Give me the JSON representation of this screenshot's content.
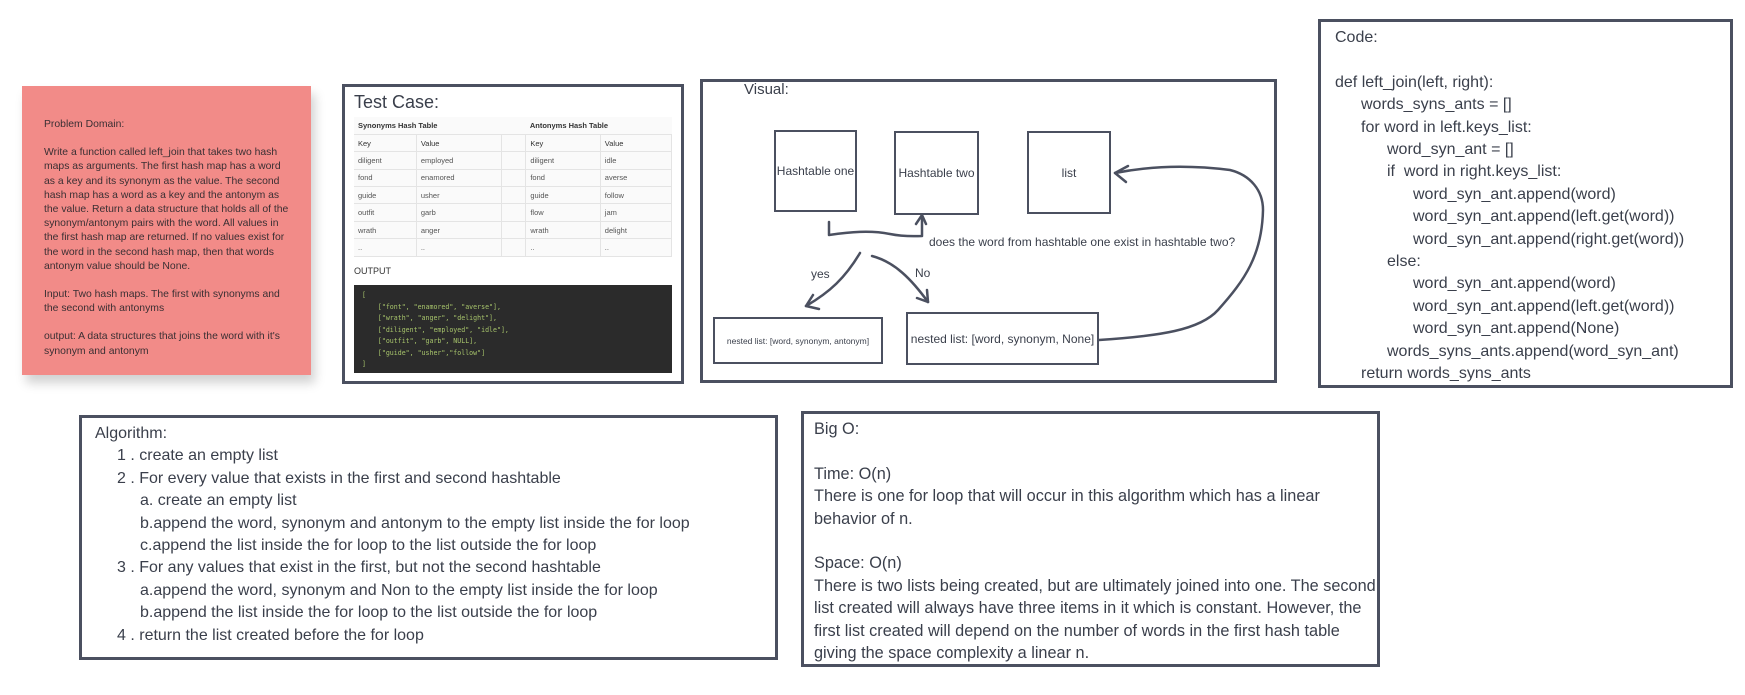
{
  "problem_domain": {
    "heading": "Problem Domain:",
    "description": "Write a function called left_join that takes two hash maps as arguments. The first hash map has a word as a key and its synonym as the value. The second hash map has a word as a key and the antonym as the value. Return a data structure that holds all of the synonym/antonym pairs with the word. All values in the first hash map are returned. If no values exist for the word in the second hash map, then that words antonym value should be None.",
    "input": "Input: Two hash maps. The first with synonyms and the second with antonyms",
    "output": "output: A data structures that joins the word with it's synonym and antonym"
  },
  "test_case": {
    "title": "Test Case:",
    "synonyms_title": "Synonyms Hash Table",
    "antonyms_title": "Antonyms Hash Table",
    "headers": [
      "Key",
      "Value",
      "Key",
      "Value"
    ],
    "rows": [
      [
        "diligent",
        "employed",
        "diligent",
        "idle"
      ],
      [
        "fond",
        "enamored",
        "fond",
        "averse"
      ],
      [
        "guide",
        "usher",
        "guide",
        "follow"
      ],
      [
        "outfit",
        "garb",
        "flow",
        "jam"
      ],
      [
        "wrath",
        "anger",
        "wrath",
        "delight"
      ],
      [
        "..",
        "..",
        "..",
        ".."
      ]
    ],
    "output_label": "OUTPUT",
    "output_code": "[\n    [\"font\", \"enamored\", \"averse\"],\n    [\"wrath\", \"anger\", \"delight\"],\n    [\"diligent\", \"employed\", \"idle\"],\n    [\"outfit\", \"garb\", NULL],\n    [\"guide\", \"usher\",\"follow\"]\n]"
  },
  "visual": {
    "title": "Visual:",
    "hashtable_one": "Hashtable one",
    "hashtable_two": "Hashtable two",
    "list": "list",
    "question": "does the word from hashtable one exist in hashtable two?",
    "yes": "yes",
    "no": "No",
    "nested_yes": "nested list: [word, synonym, antonym]",
    "nested_no": "nested list: [word, synonym, None]"
  },
  "code": {
    "title": "Code:",
    "lines": [
      {
        "indent": 0,
        "text": "def left_join(left, right):"
      },
      {
        "indent": 1,
        "text": "words_syns_ants = []"
      },
      {
        "indent": 1,
        "text": "for word in left.keys_list:"
      },
      {
        "indent": 2,
        "text": "word_syn_ant = []"
      },
      {
        "indent": 2,
        "text": "if  word in right.keys_list:"
      },
      {
        "indent": 3,
        "text": "word_syn_ant.append(word)"
      },
      {
        "indent": 3,
        "text": "word_syn_ant.append(left.get(word))"
      },
      {
        "indent": 3,
        "text": "word_syn_ant.append(right.get(word))"
      },
      {
        "indent": 2,
        "text": "else:"
      },
      {
        "indent": 3,
        "text": "word_syn_ant.append(word)"
      },
      {
        "indent": 3,
        "text": "word_syn_ant.append(left.get(word))"
      },
      {
        "indent": 3,
        "text": "word_syn_ant.append(None)"
      },
      {
        "indent": 2,
        "text": "words_syns_ants.append(word_syn_ant)"
      },
      {
        "indent": 1,
        "text": "return words_syns_ants"
      }
    ]
  },
  "algorithm": {
    "title": "Algorithm:",
    "lines": [
      {
        "indent": 1,
        "text": "1 . create an empty list"
      },
      {
        "indent": 1,
        "text": "2 . For every value that exists in the first and second hashtable"
      },
      {
        "indent": 2,
        "text": "a.  create an empty list"
      },
      {
        "indent": 2,
        "text": "b.append the word, synonym and antonym to the empty list inside the for loop"
      },
      {
        "indent": 2,
        "text": "c.append the list inside the for loop to the list outside the for loop"
      },
      {
        "indent": 1,
        "text": "3 . For any values that exist in the first, but not the second hashtable"
      },
      {
        "indent": 2,
        "text": "a.append the word, synonym and Non to the empty list inside the for loop"
      },
      {
        "indent": 2,
        "text": "b.append the list inside the for loop to the list outside the for loop"
      },
      {
        "indent": 1,
        "text": "4 . return the list created before the for loop"
      }
    ]
  },
  "big_o": {
    "title": "Big O:",
    "time_heading": "Time: O(n)",
    "time_text": "There is one for loop that will occur in this algorithm which has a linear behavior of n.",
    "space_heading": "Space: O(n)",
    "space_text": "There is two lists being created, but are ultimately joined into one. The second list created will always have three items in it which is constant. However, the first list created will depend on the number of words in the first hash table giving the space complexity a linear n."
  }
}
